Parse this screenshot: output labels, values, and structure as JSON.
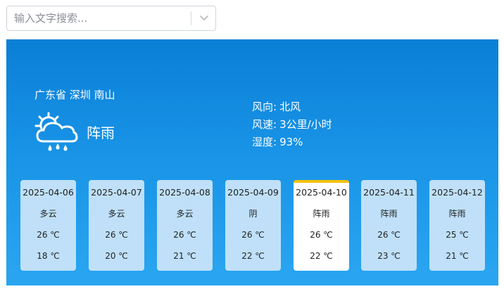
{
  "search": {
    "placeholder": "输入文字搜索..."
  },
  "current": {
    "location": "广东省 深圳 南山",
    "condition": "阵雨",
    "condition_icon": "rain-cloud-icon",
    "wind_dir_label": "风向:",
    "wind_dir": "北风",
    "wind_speed_label": "风速:",
    "wind_speed": "3公里/小时",
    "humidity_label": "湿度:",
    "humidity": "93%"
  },
  "forecast": [
    {
      "date": "2025-04-06",
      "condition": "多云",
      "high": "26 ℃",
      "low": "18 ℃",
      "selected": false
    },
    {
      "date": "2025-04-07",
      "condition": "多云",
      "high": "26 ℃",
      "low": "20 ℃",
      "selected": false
    },
    {
      "date": "2025-04-08",
      "condition": "多云",
      "high": "26 ℃",
      "low": "21 ℃",
      "selected": false
    },
    {
      "date": "2025-04-09",
      "condition": "阴",
      "high": "26 ℃",
      "low": "22 ℃",
      "selected": false
    },
    {
      "date": "2025-04-10",
      "condition": "阵雨",
      "high": "26 ℃",
      "low": "22 ℃",
      "selected": true
    },
    {
      "date": "2025-04-11",
      "condition": "阵雨",
      "high": "26 ℃",
      "low": "23 ℃",
      "selected": false
    },
    {
      "date": "2025-04-12",
      "condition": "阵雨",
      "high": "25 ℃",
      "low": "21 ℃",
      "selected": false
    }
  ],
  "colors": {
    "panel_top": "#0a7fd6",
    "panel_bottom": "#2aa6f1",
    "card": "#bfe0f8",
    "selected_accent": "#f4c20d"
  }
}
